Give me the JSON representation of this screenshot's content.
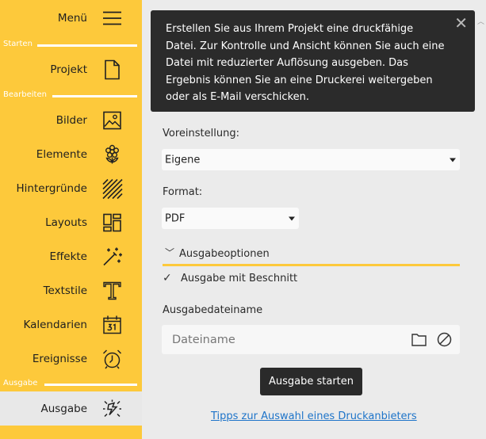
{
  "sidebar": {
    "menu_label": "Menü",
    "sections": {
      "start": "Starten",
      "edit": "Bearbeiten",
      "output": "Ausgabe"
    },
    "items": [
      {
        "label": "Projekt",
        "icon": "document-icon"
      },
      {
        "label": "Bilder",
        "icon": "image-icon"
      },
      {
        "label": "Elemente",
        "icon": "flower-icon"
      },
      {
        "label": "Hintergründe",
        "icon": "hatch-pattern-icon"
      },
      {
        "label": "Layouts",
        "icon": "layout-grid-icon"
      },
      {
        "label": "Effekte",
        "icon": "magic-wand-icon"
      },
      {
        "label": "Textstile",
        "icon": "text-style-icon"
      },
      {
        "label": "Kalendarien",
        "icon": "calendar-icon"
      },
      {
        "label": "Ereignisse",
        "icon": "alarm-clock-icon"
      },
      {
        "label": "Ausgabe",
        "icon": "output-burst-icon"
      }
    ]
  },
  "panel": {
    "tooltip_text": "Erstellen Sie aus Ihrem Projekt eine druckfähige Datei. Zur Kontrolle und Ansicht können Sie auch eine Datei mit reduzierter Auflösung ausgeben. Das Ergebnis können Sie an eine Druckerei weitergeben oder als E-Mail verschicken.",
    "close_glyph": "✕",
    "preset_label": "Voreinstellung:",
    "preset_value": "Eigene",
    "format_label": "Format:",
    "format_value": "PDF",
    "options_label": "Ausgabeoptionen",
    "trim_label": "Ausgabe mit Beschnitt",
    "trim_checked": true,
    "check_glyph": "✓",
    "filename_label": "Ausgabedateiname",
    "filename_placeholder": "Dateiname",
    "filename_value": "",
    "start_button": "Ausgabe starten",
    "help_link": "Tipps zur Auswahl eines Druckanbieters"
  },
  "colors": {
    "accent": "#fdc93b",
    "tooltip_bg": "#2b2b2b",
    "link": "#1e74c9"
  }
}
